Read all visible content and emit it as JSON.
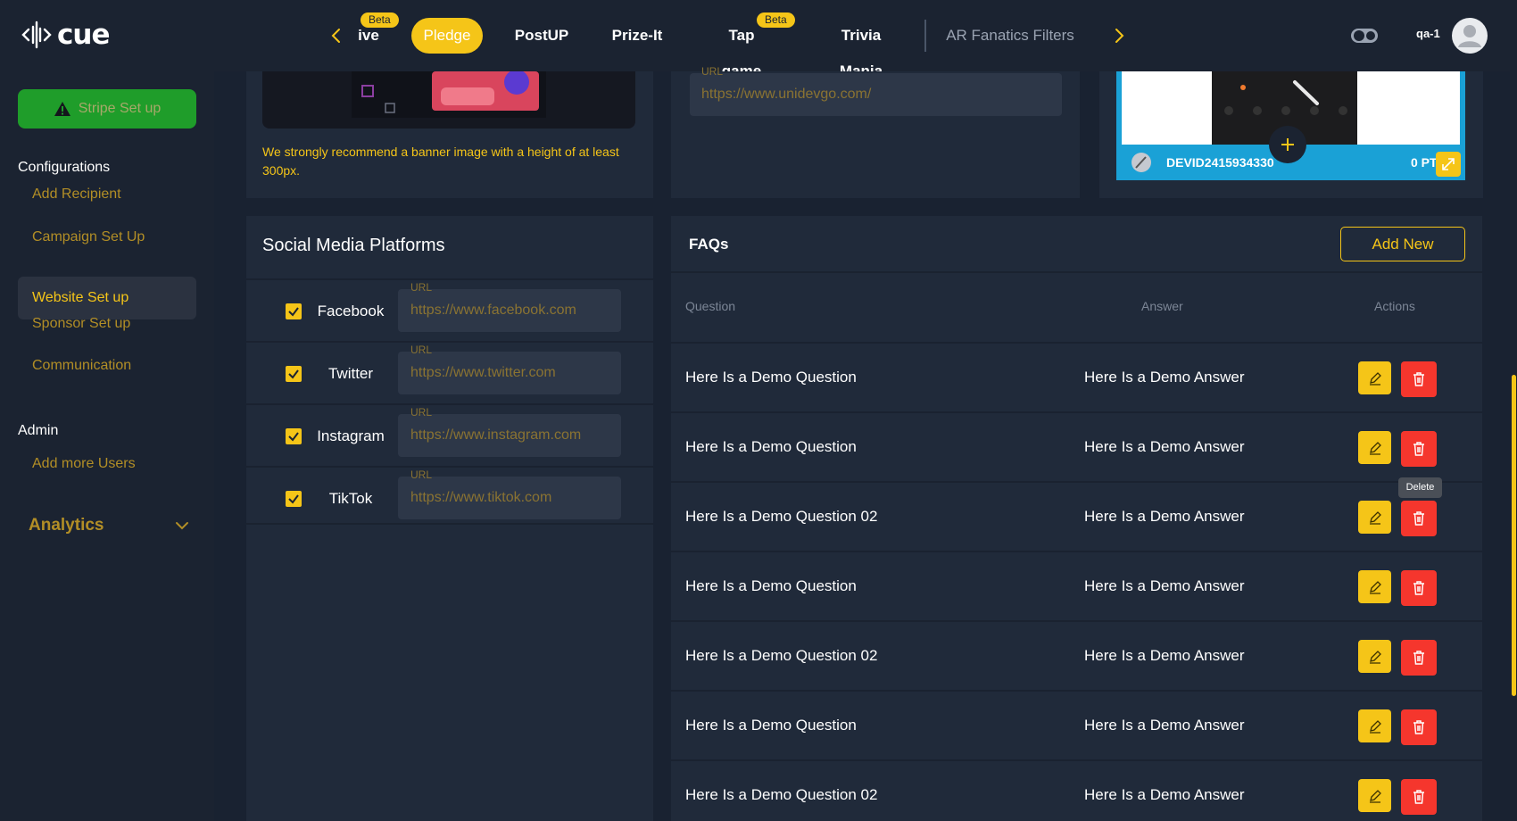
{
  "topbar": {
    "logo_text": "cue",
    "nav_items": [
      {
        "label": "ive",
        "badge": "Beta"
      },
      {
        "label": "Pledge",
        "active": true
      },
      {
        "label": "PostUP"
      },
      {
        "label": "Prize-It"
      },
      {
        "label": "Tap game",
        "badge": "Beta"
      },
      {
        "label": "Trivia Mania"
      },
      {
        "label": "AR Fanatics Filters"
      }
    ],
    "user_name": "qa-1"
  },
  "sidebar": {
    "stripe_button": "Stripe Set up",
    "configurations_heading": "Configurations",
    "config_items": [
      "Add Recipient",
      "Campaign Set Up",
      "Website Set up",
      "Sponsor Set up",
      "Communication"
    ],
    "active_item": "Website Set up",
    "admin_heading": "Admin",
    "admin_items": [
      "Add more Users"
    ],
    "analytics_label": "Analytics"
  },
  "banner": {
    "note": "We strongly recommend a banner image with a height of at least 300px."
  },
  "website_url": {
    "label": "URL",
    "value": "https://www.unidevgo.com/"
  },
  "preview": {
    "device_id": "DEVID2415934330",
    "points": "0 PT"
  },
  "social": {
    "title": "Social Media Platforms",
    "url_label": "URL",
    "platforms": [
      {
        "name": "Facebook",
        "url": "https://www.facebook.com",
        "checked": true
      },
      {
        "name": "Twitter",
        "url": "https://www.twitter.com",
        "checked": true
      },
      {
        "name": "Instagram",
        "url": "https://www.instagram.com",
        "checked": true
      },
      {
        "name": "TikTok",
        "url": "https://www.tiktok.com",
        "checked": true
      }
    ]
  },
  "faqs": {
    "title": "FAQs",
    "add_button": "Add New",
    "headers": {
      "question": "Question",
      "answer": "Answer",
      "actions": "Actions"
    },
    "rows": [
      {
        "question": "Here Is a Demo Question",
        "answer": "Here Is a Demo Answer"
      },
      {
        "question": "Here Is a Demo Question",
        "answer": "Here Is a Demo Answer"
      },
      {
        "question": "Here Is a Demo Question 02",
        "answer": "Here Is a Demo Answer"
      },
      {
        "question": "Here Is a Demo Question",
        "answer": "Here Is a Demo Answer"
      },
      {
        "question": "Here Is a Demo Question 02",
        "answer": "Here Is a Demo Answer"
      },
      {
        "question": "Here Is a Demo Question",
        "answer": "Here Is a Demo Answer"
      },
      {
        "question": "Here Is a Demo Question 02",
        "answer": "Here Is a Demo Answer"
      }
    ],
    "tooltip": "Delete"
  },
  "colors": {
    "accent": "#f5c518",
    "background": "#1b2331",
    "card": "#202a3a",
    "danger": "#f5362d",
    "success": "#1f9d2a"
  },
  "icons": [
    "cue-logo-icon",
    "chevron-left-icon",
    "chevron-right-icon",
    "theme-toggle-icon",
    "user-avatar-icon",
    "warning-icon",
    "chevron-down-icon",
    "check-icon",
    "pencil-icon",
    "trash-icon",
    "plus-icon",
    "expand-icon"
  ]
}
